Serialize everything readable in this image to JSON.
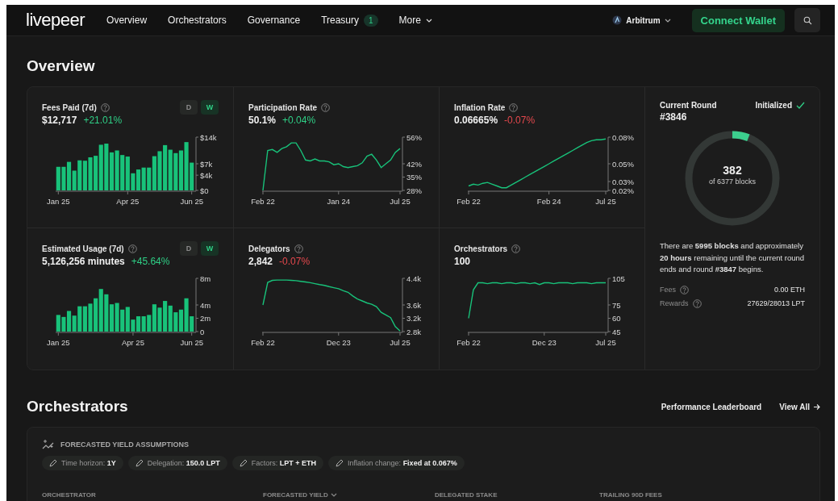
{
  "nav": {
    "logo": "livepeer",
    "items": [
      {
        "label": "Overview",
        "selected": false
      },
      {
        "label": "Orchestrators",
        "selected": false
      },
      {
        "label": "Governance",
        "selected": false
      },
      {
        "label": "Treasury",
        "badge": "1",
        "selected": false
      },
      {
        "label": "More",
        "dropdown": true,
        "selected": false
      }
    ],
    "network": "Arbitrum",
    "connect": "Connect Wallet"
  },
  "overview": {
    "title": "Overview",
    "stats": [
      {
        "label": "Fees Paid (7d)",
        "value": "$12,717",
        "change": "+21.01%",
        "color": "#2fcf86",
        "toggles": [
          {
            "label": "D",
            "selected": false
          },
          {
            "label": "W",
            "selected": true
          }
        ],
        "chart_data": {
          "type": "bar",
          "categories": [
            "Jan 25",
            null,
            null,
            null,
            null,
            null,
            null,
            null,
            null,
            null,
            null,
            null,
            null,
            "Apr 25",
            null,
            null,
            null,
            null,
            null,
            null,
            null,
            null,
            null,
            null,
            null,
            "Jun 25"
          ],
          "ylim": [
            0,
            14
          ],
          "yticks": [
            {
              "value": 0,
              "label": "$0"
            },
            {
              "value": 4,
              "label": "$4k"
            },
            {
              "value": 7,
              "label": "$7k"
            },
            {
              "value": 14,
              "label": "$14k"
            }
          ],
          "series": [
            {
              "color": "#18c27a",
              "values": [
                6.2,
                6.2,
                7.5,
                5.2,
                7.9,
                7.8,
                8.7,
                9.1,
                12,
                12.3,
                10,
                10.5,
                9.3,
                8.9,
                4.5,
                5.5,
                6,
                6,
                9,
                10.3,
                11.9,
                10.7,
                9.8,
                10.5,
                12.7,
                7.3
              ]
            }
          ]
        }
      },
      {
        "label": "Participation Rate",
        "value": "50.1%",
        "change": "+0.04%",
        "color": "#2fcf86",
        "chart_data": {
          "type": "line",
          "categories": [
            "Feb 22",
            null,
            null,
            null,
            null,
            null,
            null,
            null,
            null,
            null,
            null,
            null,
            null,
            null,
            null,
            null,
            "Jan 24",
            null,
            null,
            null,
            null,
            null,
            null,
            null,
            null,
            null,
            null,
            null,
            null,
            "Jul 25"
          ],
          "ylim": [
            28,
            56
          ],
          "yticks": [
            {
              "value": 28,
              "label": "28%"
            },
            {
              "value": 35,
              "label": "35%"
            },
            {
              "value": 42,
              "label": "42%"
            },
            {
              "value": 56,
              "label": "56%"
            }
          ],
          "series": [
            {
              "color": "#18c27a",
              "values": [
                28,
                49,
                49.5,
                48,
                50,
                51,
                53,
                53,
                49,
                44,
                43.5,
                44.5,
                43.5,
                43.5,
                43,
                41.5,
                42,
                40.5,
                40,
                40.5,
                41,
                42.5,
                46,
                47,
                44,
                40,
                42,
                44,
                48,
                50
              ]
            }
          ]
        }
      },
      {
        "label": "Inflation Rate",
        "value": "0.06665%",
        "change": "-0.07%",
        "color": "#e5484d",
        "chart_data": {
          "type": "line",
          "categories": [
            "Feb 22",
            null,
            null,
            null,
            null,
            null,
            null,
            null,
            null,
            null,
            null,
            null,
            null,
            null,
            null,
            null,
            null,
            "Feb 24",
            null,
            null,
            null,
            null,
            null,
            null,
            null,
            null,
            null,
            null,
            null,
            "Jul 25"
          ],
          "ylim": [
            0.02,
            0.08
          ],
          "yticks": [
            {
              "value": 0.02,
              "label": "0.02%"
            },
            {
              "value": 0.03,
              "label": "0.03%"
            },
            {
              "value": 0.05,
              "label": "0.05%"
            },
            {
              "value": 0.08,
              "label": "0.08%"
            }
          ],
          "series": [
            {
              "color": "#18c27a",
              "values": [
                0.025,
                0.027,
                0.026,
                0.028,
                0.029,
                0.027,
                0.025,
                0.023,
                0.023,
                0.026,
                0.029,
                0.032,
                0.035,
                0.038,
                0.041,
                0.044,
                0.047,
                0.05,
                0.053,
                0.056,
                0.059,
                0.062,
                0.065,
                0.068,
                0.071,
                0.074,
                0.076,
                0.077,
                0.077,
                0.078
              ]
            }
          ]
        }
      },
      {
        "label": "Estimated Usage (7d)",
        "value": "5,126,256 minutes",
        "change": "+45.64%",
        "color": "#2fcf86",
        "toggles": [
          {
            "label": "D",
            "selected": false
          },
          {
            "label": "W",
            "selected": true
          }
        ],
        "chart_data": {
          "type": "bar",
          "categories": [
            "Jan 25",
            null,
            null,
            null,
            null,
            null,
            null,
            null,
            null,
            null,
            null,
            null,
            null,
            null,
            "Apr 25",
            null,
            null,
            null,
            null,
            null,
            null,
            null,
            null,
            null,
            null,
            "Jun 25"
          ],
          "ylim": [
            0,
            8
          ],
          "yticks": [
            {
              "value": 0,
              "label": "0"
            },
            {
              "value": 2,
              "label": "2m"
            },
            {
              "value": 4,
              "label": "4m"
            },
            {
              "value": 8,
              "label": "8m"
            }
          ],
          "series": [
            {
              "color": "#18c27a",
              "values": [
                2.5,
                2.2,
                3.1,
                2.4,
                3.8,
                3.8,
                4.2,
                5,
                6.4,
                5.6,
                4.1,
                4.3,
                3.3,
                3.7,
                1.8,
                2.3,
                2.3,
                2.5,
                4.1,
                3.6,
                4.6,
                3.9,
                2.9,
                3.3,
                5,
                2.3
              ]
            }
          ]
        }
      },
      {
        "label": "Delegators",
        "value": "2,842",
        "change": "-0.07%",
        "color": "#e5484d",
        "chart_data": {
          "type": "line",
          "categories": [
            "Feb 22",
            null,
            null,
            null,
            null,
            null,
            null,
            null,
            null,
            null,
            null,
            null,
            null,
            null,
            null,
            null,
            "Dec 23",
            null,
            null,
            null,
            null,
            null,
            null,
            null,
            null,
            null,
            null,
            null,
            null,
            "Jul 25"
          ],
          "ylim": [
            2.8,
            4.4
          ],
          "yticks": [
            {
              "value": 2.8,
              "label": "2.8k"
            },
            {
              "value": 3.2,
              "label": "3.2k"
            },
            {
              "value": 3.6,
              "label": "3.6k"
            },
            {
              "value": 4.4,
              "label": "4.4k"
            }
          ],
          "series": [
            {
              "color": "#18c27a",
              "values": [
                3.6,
                4.28,
                4.34,
                4.35,
                4.35,
                4.35,
                4.34,
                4.33,
                4.31,
                4.29,
                4.27,
                4.24,
                4.21,
                4.19,
                4.15,
                4.12,
                4.09,
                4.03,
                3.98,
                3.87,
                3.78,
                3.72,
                3.66,
                3.62,
                3.55,
                3.38,
                3.3,
                3.22,
                2.95,
                2.82
              ]
            }
          ]
        }
      },
      {
        "label": "Orchestrators",
        "value": "100",
        "chart_data": {
          "type": "line",
          "categories": [
            "Feb 22",
            null,
            null,
            null,
            null,
            null,
            null,
            null,
            null,
            null,
            null,
            null,
            null,
            null,
            null,
            null,
            "Dec 23",
            null,
            null,
            null,
            null,
            null,
            null,
            null,
            null,
            null,
            null,
            null,
            null,
            "Jul 25"
          ],
          "ylim": [
            45,
            105
          ],
          "yticks": [
            {
              "value": 45,
              "label": "45"
            },
            {
              "value": 60,
              "label": "60"
            },
            {
              "value": 75,
              "label": "75"
            },
            {
              "value": 105,
              "label": "105"
            }
          ],
          "series": [
            {
              "color": "#18c27a",
              "values": [
                60,
                92,
                100,
                100,
                99,
                100,
                100,
                99,
                100,
                100,
                99,
                100,
                100,
                99,
                100,
                98,
                100,
                100,
                99,
                100,
                100,
                100,
                99,
                100,
                100,
                100,
                99,
                100,
                100,
                100
              ]
            }
          ]
        }
      }
    ],
    "round": {
      "label": "Current Round",
      "status": "Initialized",
      "initialized": true,
      "number": "#3846",
      "blocks": "382",
      "blocks_caption": "of 6377 blocks",
      "text": "There are **5995 blocks** and approximately **20 hours** remaining until the current round ends and round **#3847** begins.",
      "rows": [
        {
          "label": "Fees",
          "value": "0.00 ETH"
        },
        {
          "label": "Rewards",
          "value": "27629/28013 LPT"
        }
      ]
    }
  },
  "orchestrators": {
    "title": "Orchestrators",
    "links": [
      "Performance Leaderboard",
      "View All"
    ],
    "assumptions": {
      "title": "FORECASTED YIELD ASSUMPTIONS",
      "chips": [
        {
          "label": "Time horizon:",
          "value": "1Y"
        },
        {
          "label": "Delegation:",
          "value": "150.0 LPT"
        },
        {
          "label": "Factors:",
          "value": "LPT + ETH"
        },
        {
          "label": "Inflation change:",
          "value": "Fixed at 0.067%"
        }
      ]
    },
    "table": {
      "columns": [
        {
          "label": "ORCHESTRATOR",
          "sorted": false
        },
        {
          "label": "FORECASTED YIELD",
          "sorted": true
        },
        {
          "label": "DELEGATED STAKE",
          "sorted": false
        },
        {
          "label": "TRAILING 90D FEES",
          "sorted": false
        }
      ]
    }
  }
}
